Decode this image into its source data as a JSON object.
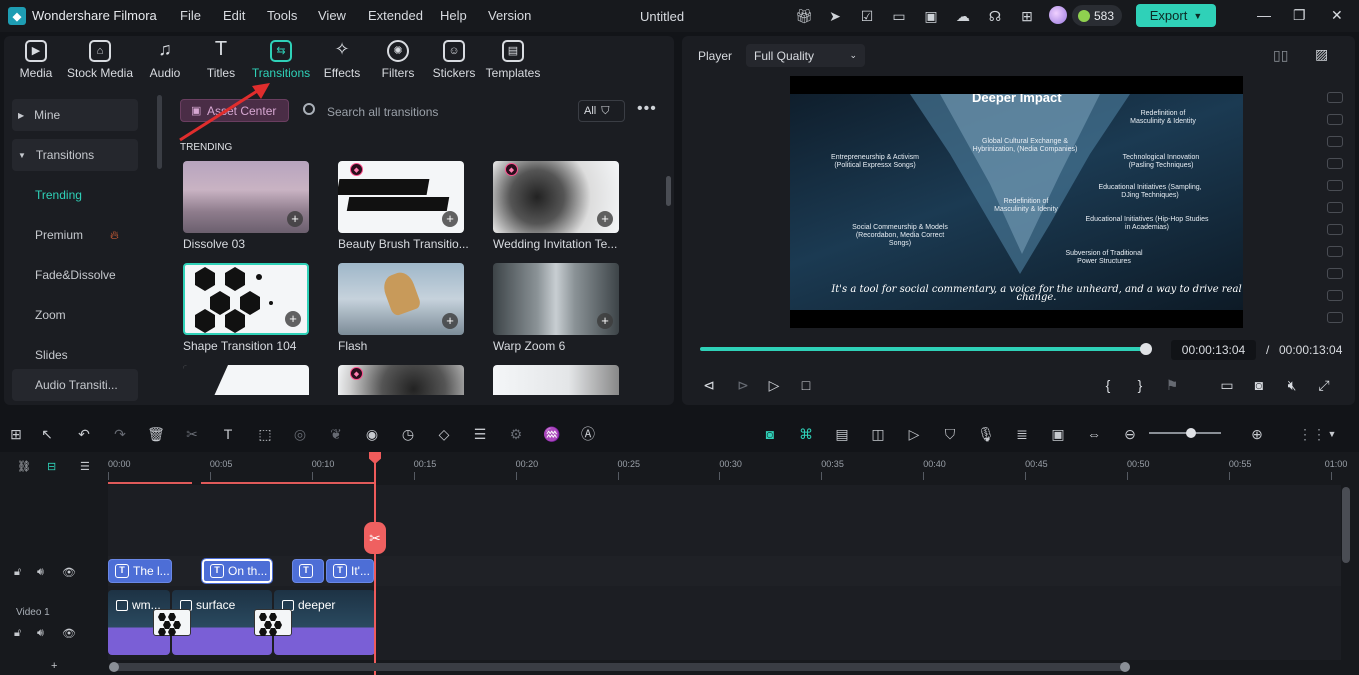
{
  "app": {
    "name": "Wondershare Filmora",
    "doc_title": "Untitled",
    "coins": "583",
    "export_label": "Export"
  },
  "menu": [
    "File",
    "Edit",
    "Tools",
    "View",
    "Extended",
    "Help",
    "Version"
  ],
  "tabs": [
    {
      "label": "Media"
    },
    {
      "label": "Stock Media"
    },
    {
      "label": "Audio"
    },
    {
      "label": "Titles"
    },
    {
      "label": "Transitions",
      "active": true
    },
    {
      "label": "Effects"
    },
    {
      "label": "Filters"
    },
    {
      "label": "Stickers"
    },
    {
      "label": "Templates"
    }
  ],
  "sidebar": {
    "mine": "Mine",
    "transitions": "Transitions",
    "items": [
      "Trending",
      "Premium",
      "Fade&Dissolve",
      "Zoom",
      "Slides",
      "Audio Transiti..."
    ]
  },
  "library": {
    "asset_center": "Asset Center",
    "search_placeholder": "Search all transitions",
    "filter_all": "All",
    "section": "TRENDING",
    "cards": [
      {
        "name": "Dissolve 03",
        "premium": false
      },
      {
        "name": "Beauty Brush Transitio...",
        "premium": true
      },
      {
        "name": "Wedding Invitation Te...",
        "premium": true
      },
      {
        "name": "Shape Transition 104",
        "premium": false,
        "selected": true
      },
      {
        "name": "Flash",
        "premium": false
      },
      {
        "name": "Warp Zoom 6",
        "premium": false
      },
      {
        "name": "",
        "premium": false
      },
      {
        "name": "",
        "premium": true
      },
      {
        "name": "",
        "premium": false
      }
    ]
  },
  "player": {
    "label": "Player",
    "quality": "Full Quality",
    "current_time": "00:00:13:04",
    "separator": "/",
    "total_time": "00:00:13:04",
    "progress": 1.0
  },
  "video": {
    "title": "Deeper Impact",
    "labels": [
      "Redefinition of Masculinity & Identity",
      "Global Cultural Exchange & Hybrinization, (Nedia Companies)",
      "Entrepreneurship & Activism (Political Expressx Songs)",
      "Technological Innovation (Pasling Techniques)",
      "Educational Initiatives (Sampling, DJing Techniques)",
      "Redefinition of Masculinity & Idenity",
      "Educational Initiatives (Hip-Hop Studies in Academias)",
      "Social Commeurship & Models (Recordabon, Media Correct Songs)",
      "Subversion of Traditional Power Structures"
    ],
    "caption": "It's a tool for social commentary, a voice for the unheard, and a way to drive real change."
  },
  "timeline": {
    "ticks": [
      "00:00",
      "00:05",
      "00:10",
      "00:15",
      "00:20",
      "00:25",
      "00:30",
      "00:35",
      "00:40",
      "00:45",
      "00:50",
      "00:55",
      "01:00"
    ],
    "text_clips": [
      "The l...",
      "On th...",
      "",
      "It'..."
    ],
    "video_clips": [
      "wm...",
      "surface",
      "deeper"
    ],
    "track_label": "Video 1"
  },
  "colors": {
    "accent": "#2fd1b8",
    "playhead": "#ef5b5b",
    "text_clip": "#4d6ed6",
    "audio_clip": "#7a5fd6",
    "annotation_arrow": "#e02d2d"
  }
}
